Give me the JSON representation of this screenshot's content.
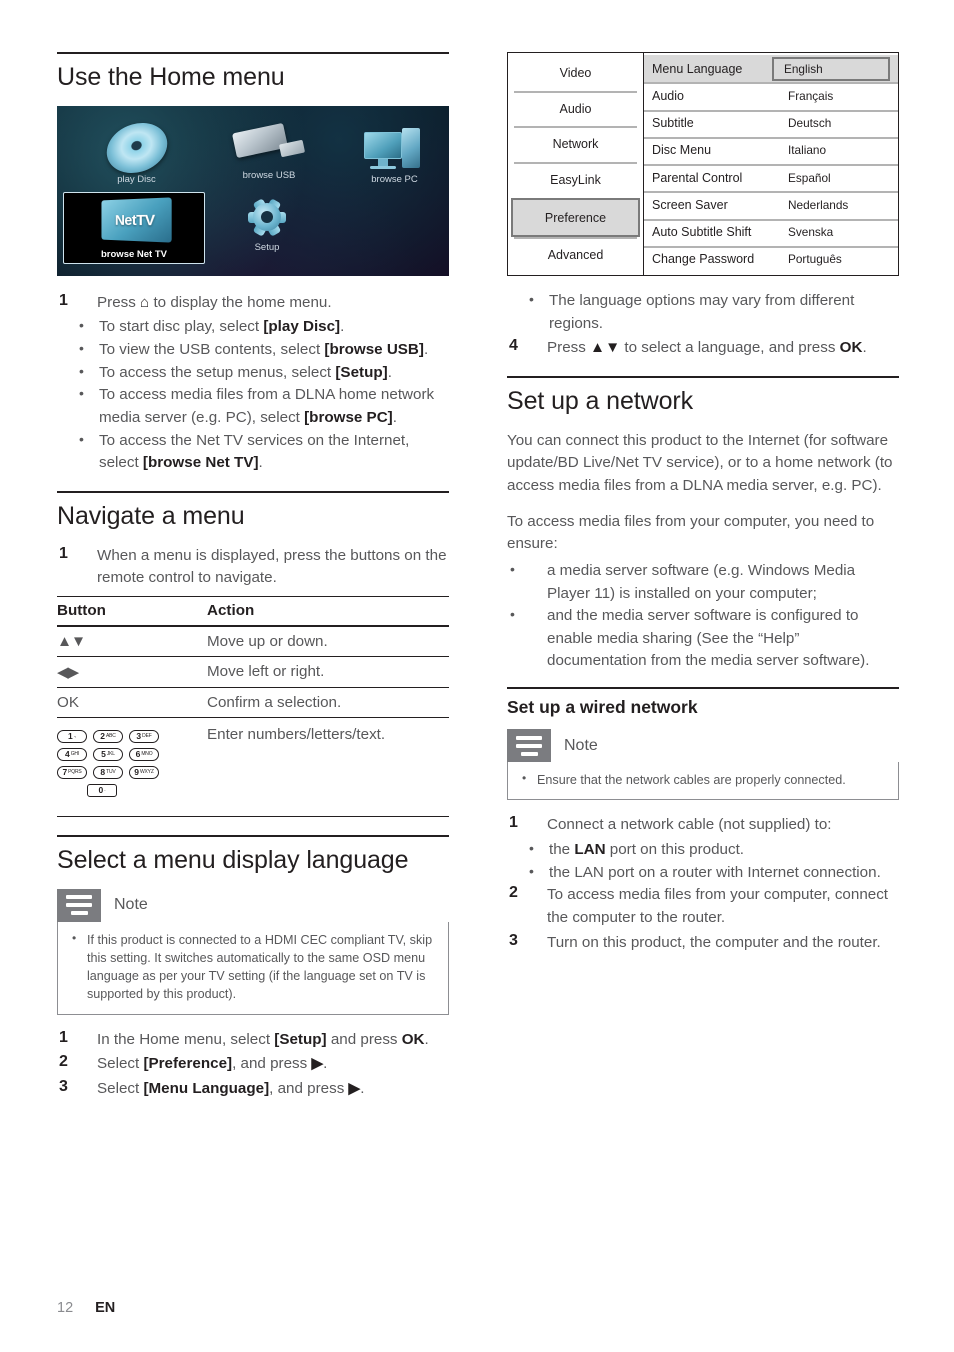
{
  "sections": {
    "home_menu": {
      "title": "Use the Home menu",
      "screenshot": {
        "tiles": [
          {
            "icon": "disc-icon",
            "caption": "play Disc"
          },
          {
            "icon": "usb-drive-icon",
            "caption": "browse USB"
          },
          {
            "icon": "computer-icon",
            "caption": "browse PC"
          },
          {
            "icon": "nettv-icon",
            "caption": "browse Net TV",
            "logo": "NetTV",
            "selected": true
          },
          {
            "icon": "gear-icon",
            "caption": "Setup"
          }
        ]
      },
      "step1_num": "1",
      "step1_text": "Press ⌂ to display the home menu.",
      "bullets": [
        "To start disc play, select [play Disc].",
        "To view the USB contents, select [browse USB].",
        "To access the setup menus, select [Setup].",
        "To access media files from a DLNA home network media server (e.g. PC), select [browse PC].",
        "To access the Net TV services on the Internet, select [browse Net TV]."
      ]
    },
    "navigate_menu": {
      "title": "Navigate a menu",
      "step1_num": "1",
      "step1_text": "When a menu is displayed, press the buttons on the remote control to navigate.",
      "table": {
        "headers": [
          "Button",
          "Action"
        ],
        "rows": [
          {
            "button": "▲▼",
            "action": "Move up or down."
          },
          {
            "button": "◀▶",
            "action": "Move left or right."
          },
          {
            "button": "OK",
            "action": "Confirm a selection."
          },
          {
            "button": "keypad-graphic",
            "action": "Enter numbers/letters/text."
          }
        ]
      },
      "keypad": [
        [
          {
            "digit": "1",
            "letters": ".,"
          },
          {
            "digit": "2",
            "letters": "ABC"
          },
          {
            "digit": "3",
            "letters": "DEF"
          }
        ],
        [
          {
            "digit": "4",
            "letters": "GHI"
          },
          {
            "digit": "5",
            "letters": "JKL"
          },
          {
            "digit": "6",
            "letters": "MNO"
          }
        ],
        [
          {
            "digit": "7",
            "letters": "PQRS"
          },
          {
            "digit": "8",
            "letters": "TUV"
          },
          {
            "digit": "9",
            "letters": "WXYZ"
          }
        ],
        [
          {
            "digit": "0",
            "letters": "."
          }
        ]
      ]
    },
    "select_language": {
      "title": "Select a menu display language",
      "note_label": "Note",
      "note_items": [
        "If this product is connected to a HDMI CEC compliant TV, skip this setting. It switches automatically to the same OSD menu language as per your TV setting (if the language set on TV is supported by this product)."
      ],
      "steps": [
        {
          "num": "1",
          "text": "In the Home menu, select [Setup] and press OK."
        },
        {
          "num": "2",
          "text": "Select [Preference], and press ▶."
        },
        {
          "num": "3",
          "text": "Select [Menu Language], and press ▶."
        }
      ]
    },
    "setup_menu_mock": {
      "categories": [
        "Video",
        "Audio",
        "Network",
        "EasyLink",
        "Preference",
        "Advanced"
      ],
      "selected_category": "Preference",
      "settings": [
        {
          "label": "Menu Language",
          "value": "English"
        },
        {
          "label": "Audio",
          "value": "Français"
        },
        {
          "label": "Subtitle",
          "value": "Deutsch"
        },
        {
          "label": "Disc Menu",
          "value": "Italiano"
        },
        {
          "label": "Parental Control",
          "value": "Español"
        },
        {
          "label": "Screen Saver",
          "value": "Nederlands"
        },
        {
          "label": "Auto Subtitle Shift",
          "value": "Svenska"
        },
        {
          "label": "Change Password",
          "value": "Português"
        }
      ],
      "selected_setting": "Menu Language",
      "selected_value": "English"
    },
    "language_note": {
      "bullet": "The language options may vary from different regions.",
      "step4_num": "4",
      "step4_text": "Press ▲▼ to select a language, and press OK."
    },
    "setup_network": {
      "title": "Set up a network",
      "para1": "You can connect this product to the Internet (for software update/BD Live/Net TV service), or to a home network (to access media files from a DLNA media server, e.g. PC).",
      "para2": "To access media files from your computer, you need to ensure:",
      "bullets": [
        "a media server software (e.g. Windows Media Player 11) is installed on your computer;",
        "and the media server software is configured to enable media sharing (See the “Help” documentation from the media server software)."
      ]
    },
    "wired_network": {
      "title": "Set up a wired network",
      "note_label": "Note",
      "note_items": [
        "Ensure that the network cables are properly connected."
      ],
      "steps": [
        {
          "num": "1",
          "text": "Connect a network cable (not supplied) to:"
        },
        {
          "num": "2",
          "text": "To access media files from your computer, connect the computer to the router."
        },
        {
          "num": "3",
          "text": "Turn on this product, the computer and the router."
        }
      ],
      "step1_bullets": [
        "the LAN port on this product.",
        "the LAN port on a router with Internet connection."
      ]
    }
  },
  "footer": {
    "page_number": "12",
    "language_code": "EN"
  },
  "colors": {
    "body_text": "#58585a",
    "heading_text": "#231f20",
    "note_icon_bg": "#7b7c80",
    "menu_highlight": "#d9d9d9",
    "menu_border": "#7a7a7a"
  }
}
